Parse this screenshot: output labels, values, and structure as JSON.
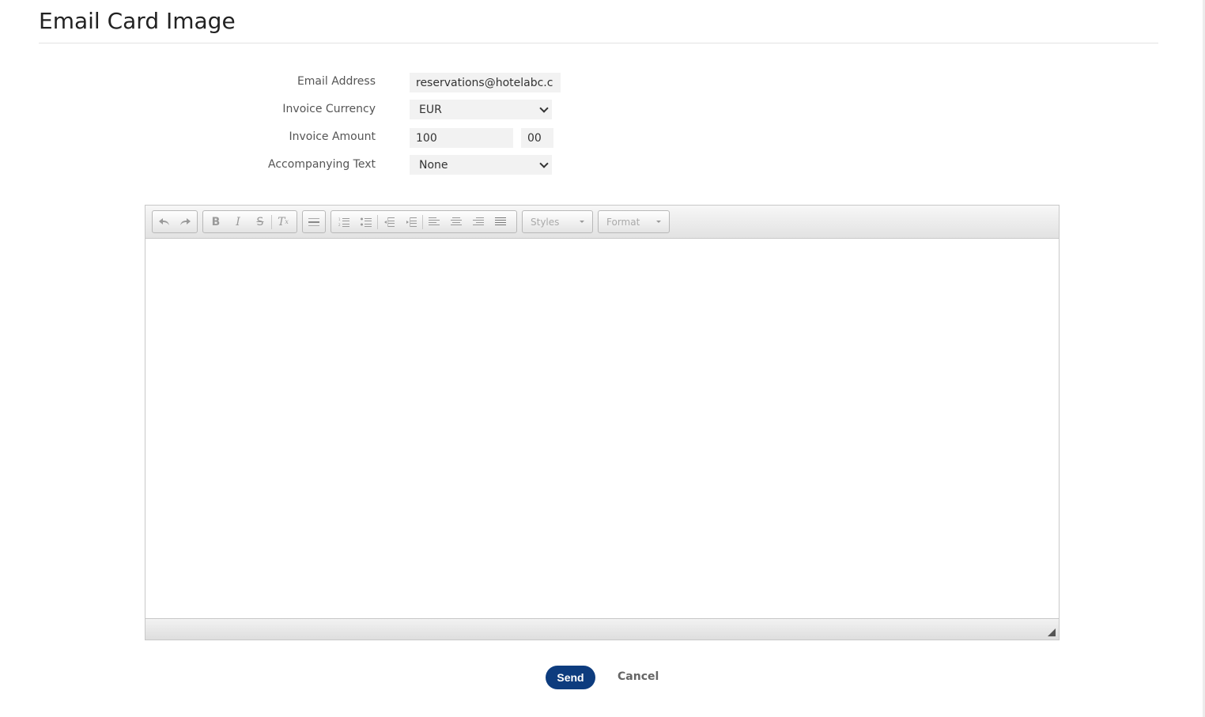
{
  "page": {
    "title": "Email Card Image"
  },
  "form": {
    "email_label": "Email Address",
    "email_value": "reservations@hotelabc.c",
    "currency_label": "Invoice Currency",
    "currency_value": "EUR",
    "amount_label": "Invoice Amount",
    "amount_whole": "100",
    "amount_cents": "00",
    "text_label": "Accompanying Text",
    "text_value": "None"
  },
  "editor": {
    "styles_label": "Styles",
    "format_label": "Format",
    "toolbar_icons": [
      "undo-icon",
      "redo-icon",
      "bold-icon",
      "italic-icon",
      "strikethrough-icon",
      "remove-format-icon",
      "horizontal-rule-icon",
      "numbered-list-icon",
      "bulleted-list-icon",
      "decrease-indent-icon",
      "increase-indent-icon",
      "align-left-icon",
      "align-center-icon",
      "align-right-icon",
      "justify-icon"
    ]
  },
  "actions": {
    "send_label": "Send",
    "cancel_label": "Cancel"
  },
  "colors": {
    "primary": "#0d3c7e",
    "field_bg": "#f2f2f2"
  }
}
